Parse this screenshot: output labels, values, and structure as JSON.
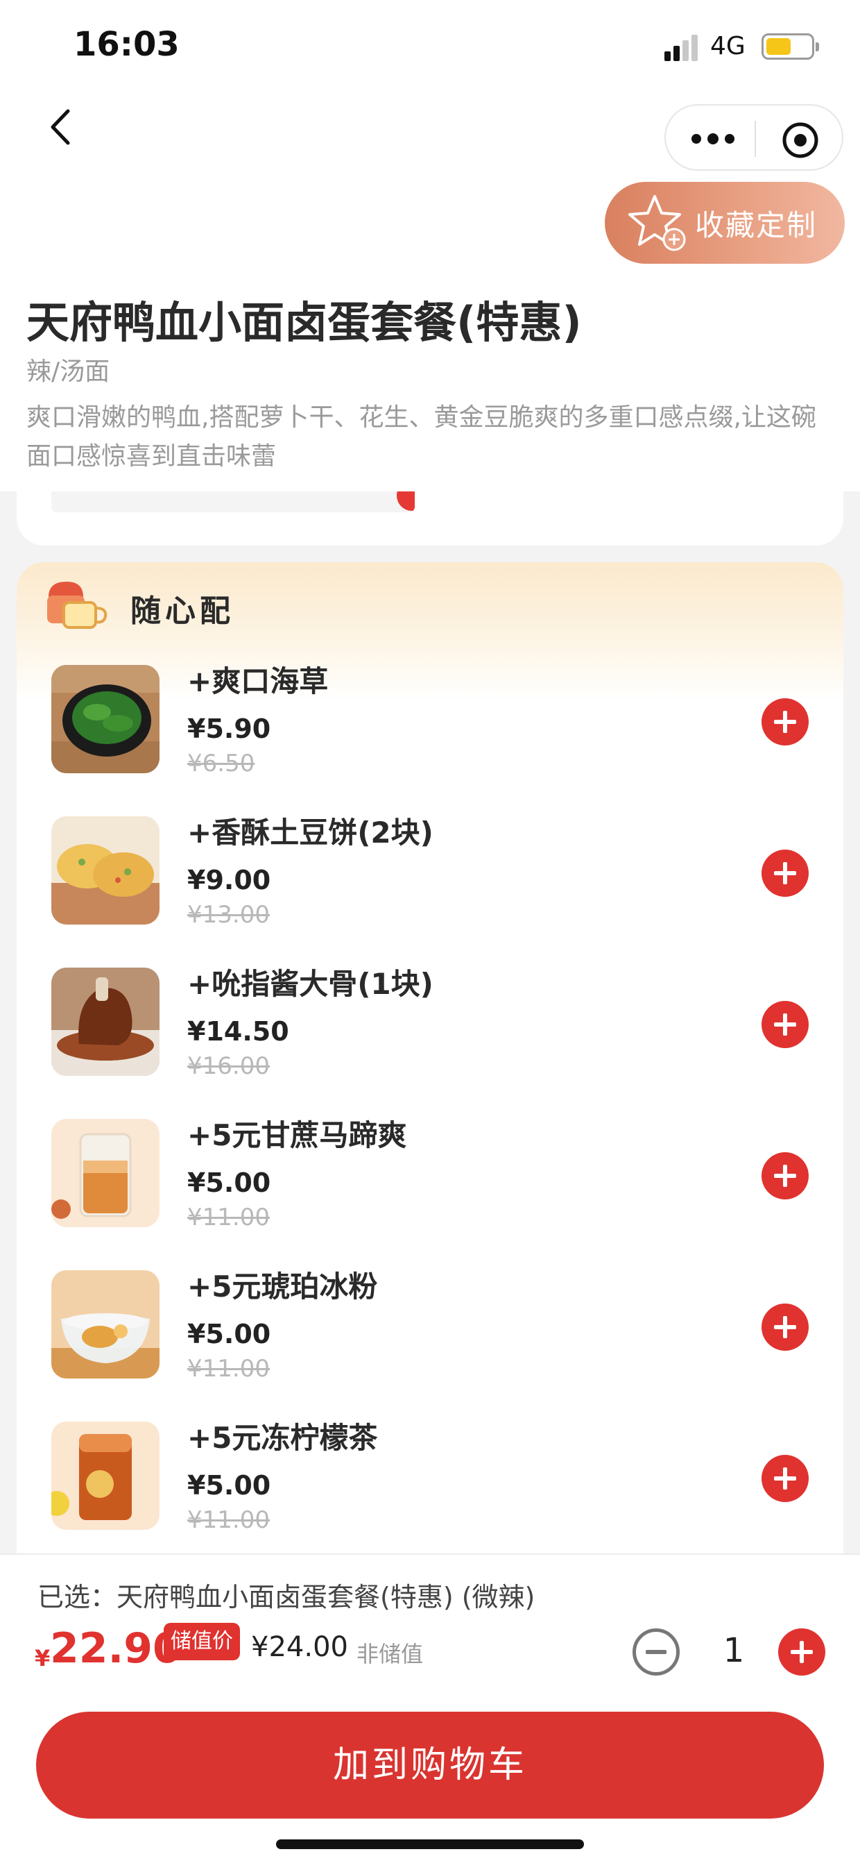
{
  "status_bar": {
    "time": "16:03",
    "network": "4G",
    "battery_level": 0.55
  },
  "nav": {
    "back_icon": "chevron-left-icon",
    "more_icon": "more-dots-icon",
    "close_icon": "target-close-icon"
  },
  "favorite": {
    "label": "收藏定制",
    "icon": "star-plus-icon"
  },
  "product": {
    "title": "天府鸭血小面卤蛋套餐(特惠)",
    "category": "辣/汤面",
    "description": "爽口滑嫩的鸭血,搭配萝卜干、花生、黄金豆脆爽的多重口感点缀,让这碗面口感惊喜到直击味蕾"
  },
  "addons": {
    "title": "随心配",
    "items": [
      {
        "name": "+爽口海草",
        "price": "¥5.90",
        "original_price": "¥6.50"
      },
      {
        "name": "+香酥土豆饼(2块)",
        "price": "¥9.00",
        "original_price": "¥13.00"
      },
      {
        "name": "+吮指酱大骨(1块)",
        "price": "¥14.50",
        "original_price": "¥16.00"
      },
      {
        "name": "+5元甘蔗马蹄爽",
        "price": "¥5.00",
        "original_price": "¥11.00"
      },
      {
        "name": "+5元琥珀冰粉",
        "price": "¥5.00",
        "original_price": "¥11.00"
      },
      {
        "name": "+5元冻柠檬茶",
        "price": "¥5.00",
        "original_price": "¥11.00"
      }
    ]
  },
  "bottom": {
    "selected": "已选：天府鸭血小面卤蛋套餐(特惠) (微辣)",
    "currency": "¥",
    "price": "22.90",
    "badge": "储值价",
    "other_price": "¥24.00",
    "other_label": "非储值",
    "quantity": "1",
    "cart_label": "加到购物车"
  },
  "colors": {
    "accent": "#e0322f",
    "cart_button": "#da3430",
    "favorite_start": "#d9805f",
    "favorite_end": "#f1b7a0"
  }
}
